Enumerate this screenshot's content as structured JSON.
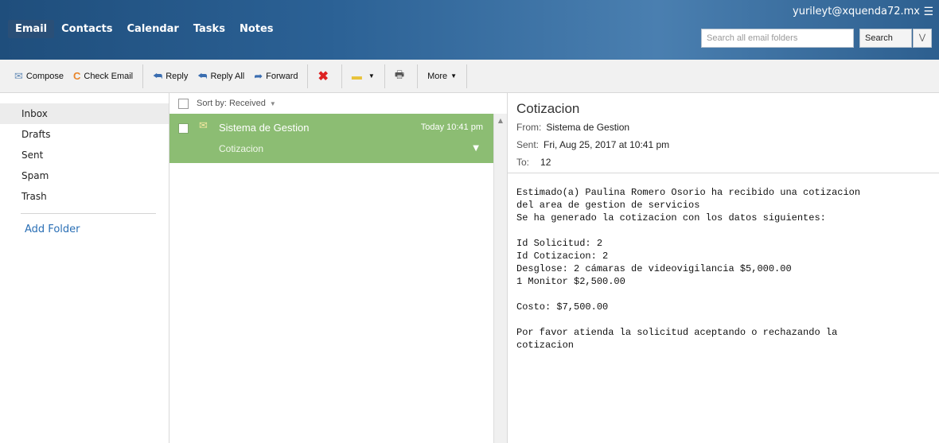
{
  "header": {
    "tabs": [
      "Email",
      "Contacts",
      "Calendar",
      "Tasks",
      "Notes"
    ],
    "account": "yurileyt@xquenda72.mx",
    "search_placeholder": "Search all email folders",
    "search_button": "Search"
  },
  "toolbar": {
    "compose": "Compose",
    "check_email": "Check Email",
    "reply": "Reply",
    "reply_all": "Reply All",
    "forward": "Forward",
    "more": "More"
  },
  "folders": {
    "items": [
      "Inbox",
      "Drafts",
      "Sent",
      "Spam",
      "Trash"
    ],
    "add_folder": "Add Folder"
  },
  "list": {
    "sort_label": "Sort by: Received",
    "message": {
      "sender": "Sistema de Gestion",
      "time": "Today 10:41 pm",
      "subject": "Cotizacion"
    }
  },
  "reader": {
    "subject": "Cotizacion",
    "from_label": "From:",
    "from": "Sistema de Gestion",
    "sent_label": "Sent:",
    "sent": "Fri, Aug 25, 2017 at 10:41 pm",
    "to_label": "To:",
    "to": "12",
    "body": "Estimado(a) Paulina Romero Osorio ha recibido una cotizacion\ndel area de gestion de servicios\nSe ha generado la cotizacion con los datos siguientes:\n\nId Solicitud: 2\nId Cotizacion: 2\nDesglose: 2 cámaras de videovigilancia $5,000.00\n1 Monitor $2,500.00\n\nCosto: $7,500.00\n\nPor favor atienda la solicitud aceptando o rechazando la\ncotizacion"
  },
  "colors": {
    "header": "#2b6195",
    "selected_message": "#8cbd73",
    "link": "#2a6fb5"
  }
}
